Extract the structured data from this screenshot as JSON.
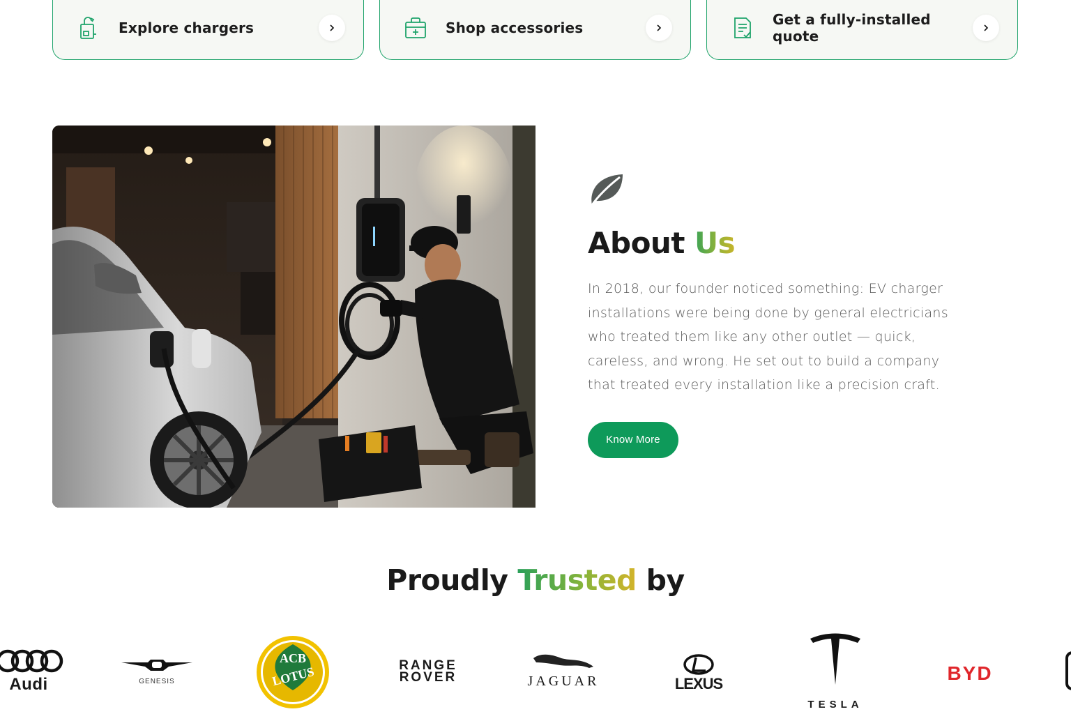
{
  "action_cards": [
    {
      "label": "Explore chargers",
      "icon": "charger-icon"
    },
    {
      "label": "Shop accessories",
      "icon": "shopping-bag-icon"
    },
    {
      "label": "Get a fully-installed quote",
      "icon": "quote-document-icon"
    }
  ],
  "about": {
    "title_main": "About",
    "title_accent": "Us",
    "body": "In 2018, our founder noticed something: EV charger installations were being done by general electricians who treated them like any other outlet — quick, careless, and wrong. He set out to build a company that treated every installation like a precision craft.",
    "button_label": "Know More",
    "icon": "leaf-icon"
  },
  "trusted": {
    "title_before": "Proudly",
    "title_accent": "Trusted",
    "title_after": "by",
    "logos": [
      {
        "name": "Audi",
        "text": "Audi"
      },
      {
        "name": "Genesis",
        "text": "GENESIS"
      },
      {
        "name": "Lotus",
        "text": "LOTUS"
      },
      {
        "name": "Range Rover",
        "line1": "RANGE",
        "line2": "ROVER"
      },
      {
        "name": "Jaguar",
        "text": "JAGUAR"
      },
      {
        "name": "Lexus",
        "text": "LEXUS"
      },
      {
        "name": "Tesla",
        "text": "TESLA"
      },
      {
        "name": "BYD",
        "text": "BYD"
      }
    ]
  },
  "colors": {
    "brand_green": "#0e9a5a",
    "card_border": "#1ea36a",
    "accent_gradient_start": "#3aa356",
    "accent_gradient_end": "#c8b42a",
    "byd_red": "#e0262b"
  }
}
